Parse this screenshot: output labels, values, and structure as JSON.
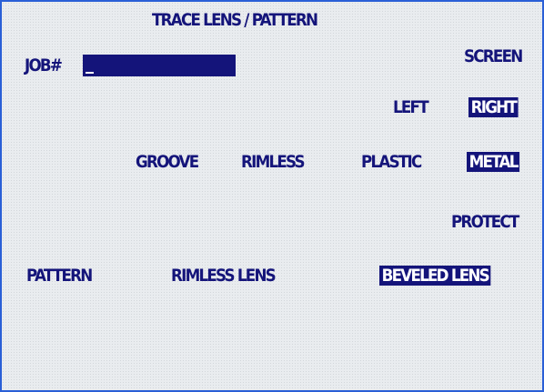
{
  "header": {
    "title": "TRACE LENS / PATTERN"
  },
  "job": {
    "label": "JOB#",
    "value": ""
  },
  "screen_label": "SCREEN",
  "side": {
    "left": "LEFT",
    "right": "RIGHT",
    "selected": "right"
  },
  "frame_type": {
    "groove": "GROOVE",
    "rimless": "RIMLESS",
    "plastic": "PLASTIC",
    "metal": "METAL",
    "selected": "metal"
  },
  "protect_label": "PROTECT",
  "pattern": {
    "label": "PATTERN",
    "rimless_lens": "RIMLESS LENS",
    "beveled_lens": "BEVELED LENS",
    "selected": "beveled_lens"
  },
  "colors": {
    "text": "#14147a",
    "highlight": "#14147a",
    "highlight_text": "#ffffff",
    "frame": "#2a5fd6"
  }
}
